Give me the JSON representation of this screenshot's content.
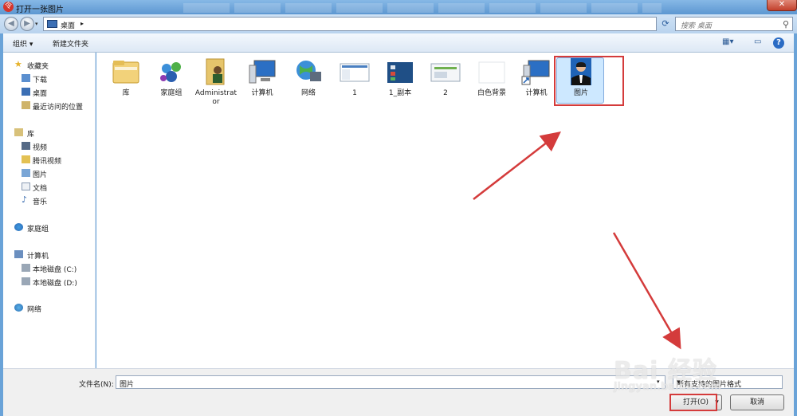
{
  "window": {
    "title": "打开一张图片",
    "close": "✕"
  },
  "address": {
    "path": "桌面",
    "search_placeholder": "搜索 桌面"
  },
  "toolbar": {
    "organize": "组织 ▾",
    "new_folder": "新建文件夹"
  },
  "sidebar": {
    "favorites": {
      "label": "收藏夹",
      "items": [
        "下载",
        "桌面",
        "最近访问的位置"
      ]
    },
    "libraries": {
      "label": "库",
      "items": [
        "视频",
        "腾讯视频",
        "图片",
        "文档",
        "音乐"
      ]
    },
    "homegroup": "家庭组",
    "computer": {
      "label": "计算机",
      "items": [
        "本地磁盘 (C:)",
        "本地磁盘 (D:)"
      ]
    },
    "network": "网络"
  },
  "files": [
    "库",
    "家庭组",
    "Administrator",
    "计算机",
    "网络",
    "1",
    "1_副本",
    "2",
    "白色背景",
    "计算机",
    "图片"
  ],
  "bottom": {
    "filename_label": "文件名(N):",
    "filename_value": "图片",
    "filetype_value": "所有支持的图片格式",
    "open_button": "打开(O)",
    "cancel_button": "取消"
  },
  "watermark": {
    "main": "Bai 经验",
    "sub": "jingyan.baidu.com"
  },
  "colors": {
    "highlight": "#d43b3b",
    "selection": "#cde8ff",
    "titlebar": "#6aa3d8"
  }
}
